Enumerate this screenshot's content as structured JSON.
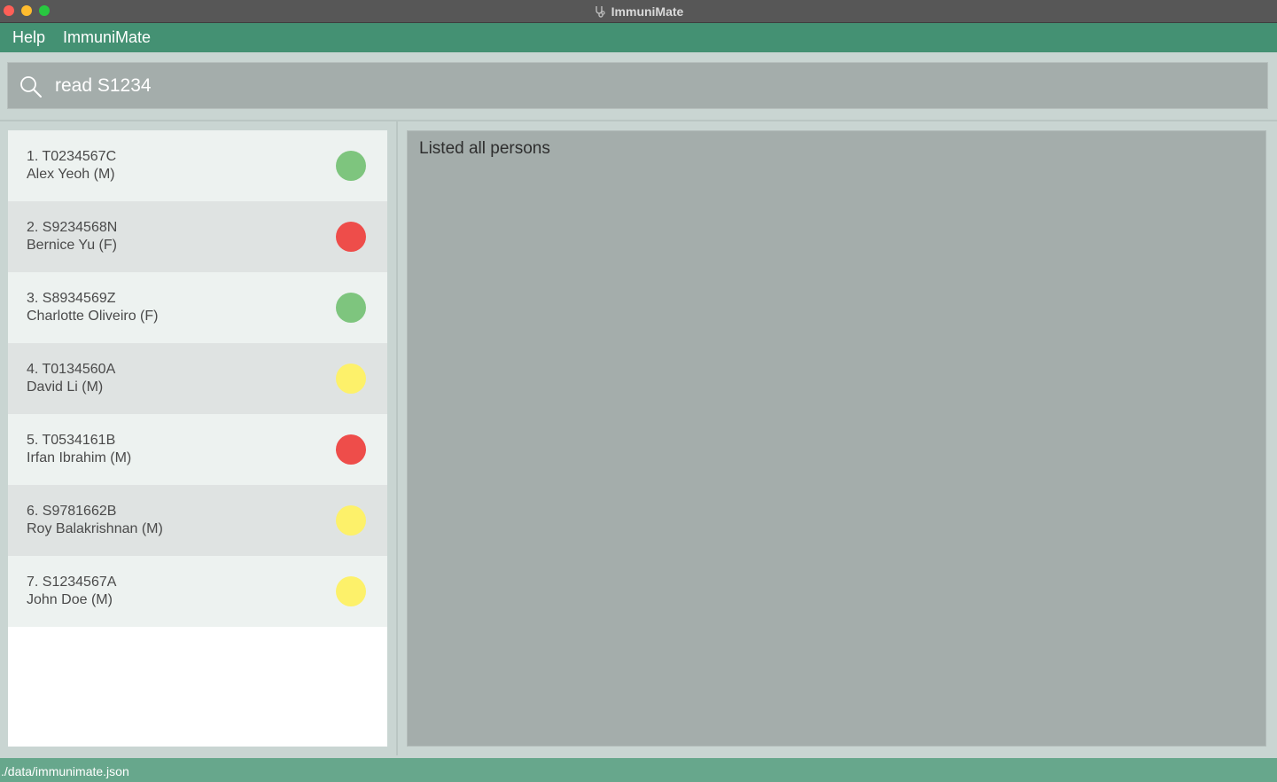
{
  "window": {
    "title": "ImmuniMate"
  },
  "menu": {
    "items": [
      {
        "label": "Help"
      },
      {
        "label": "ImmuniMate"
      }
    ]
  },
  "command": {
    "value": "read S1234",
    "icon": "search-icon"
  },
  "persons": [
    {
      "id_line": "1.  T0234567C",
      "name_line": "Alex Yeoh (M)",
      "status_color": "#7ec57e"
    },
    {
      "id_line": "2.  S9234568N",
      "name_line": "Bernice Yu (F)",
      "status_color": "#ee4d4a"
    },
    {
      "id_line": "3.  S8934569Z",
      "name_line": "Charlotte Oliveiro (F)",
      "status_color": "#7ec57e"
    },
    {
      "id_line": "4.  T0134560A",
      "name_line": "David Li (M)",
      "status_color": "#fdf16a"
    },
    {
      "id_line": "5.  T0534161B",
      "name_line": "Irfan Ibrahim (M)",
      "status_color": "#ee4d4a"
    },
    {
      "id_line": "6.  S9781662B",
      "name_line": "Roy Balakrishnan (M)",
      "status_color": "#fdf16a"
    },
    {
      "id_line": "7.  S1234567A",
      "name_line": "John Doe (M)",
      "status_color": "#fdf16a"
    }
  ],
  "result": {
    "message": "Listed all persons"
  },
  "status_bar": {
    "path": "./data/immunimate.json"
  },
  "colors": {
    "menubar": "#449173",
    "statusbar": "#67a78c",
    "panel": "#a4adab",
    "green": "#7ec57e",
    "red": "#ee4d4a",
    "yellow": "#fdf16a"
  }
}
